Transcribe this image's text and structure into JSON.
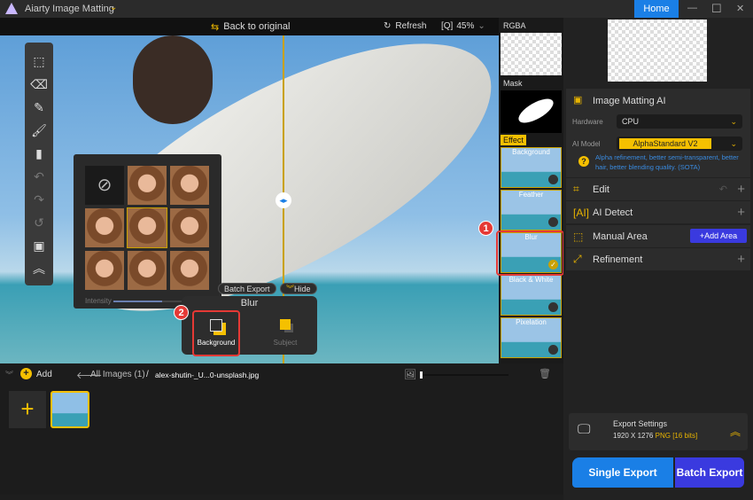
{
  "app": {
    "title": "Aiarty Image Matting",
    "home": "Home",
    "minimize": "—",
    "maximize": "☐",
    "close": "✕"
  },
  "toolbar": {
    "back": "Back to original",
    "refresh": "Refresh",
    "zoom": "45%"
  },
  "effects": {
    "rgba": "RGBA",
    "mask": "Mask",
    "effect": "Effect",
    "items": [
      {
        "label": "Background"
      },
      {
        "label": "Feather"
      },
      {
        "label": "Blur",
        "selected": true
      },
      {
        "label": "Black & White"
      },
      {
        "label": "Pixelation"
      }
    ]
  },
  "faces": {
    "intensity_label": "Intensity",
    "intensity_value": "50",
    "intensity_fraction": 0.5
  },
  "blur_panel": {
    "title": "Blur",
    "batch_export": "Batch Export",
    "hide": "Hide",
    "background": "Background",
    "subject": "Subject"
  },
  "badges": {
    "one": "1",
    "two": "2"
  },
  "right": {
    "matting_title": "Image Matting AI",
    "hardware_label": "Hardware",
    "hardware_value": "CPU",
    "model_label": "AI Model",
    "model_value": "AlphaStandard  V2",
    "model_desc": "Alpha refinement, better semi-transparent, better hair, better blending quality. (SOTA)",
    "edit": "Edit",
    "ai_detect": "AI Detect",
    "manual_area": "Manual Area",
    "add_area": "Add Area",
    "refinement": "Refinement"
  },
  "export": {
    "title": "Export Settings",
    "size": "1920 X 1276",
    "format": "PNG",
    "bits": "[16 bits]",
    "single": "Single Export",
    "batch": "Batch Export"
  },
  "bottom": {
    "add": "Add",
    "all_images": "All Images (1)",
    "sep": "/",
    "filename": "alex-shutin-_U...0-unsplash.jpg"
  },
  "colors": {
    "accent": "#f5c000",
    "blue": "#1a7fe6",
    "purple": "#3a3adf",
    "red": "#e53935"
  }
}
